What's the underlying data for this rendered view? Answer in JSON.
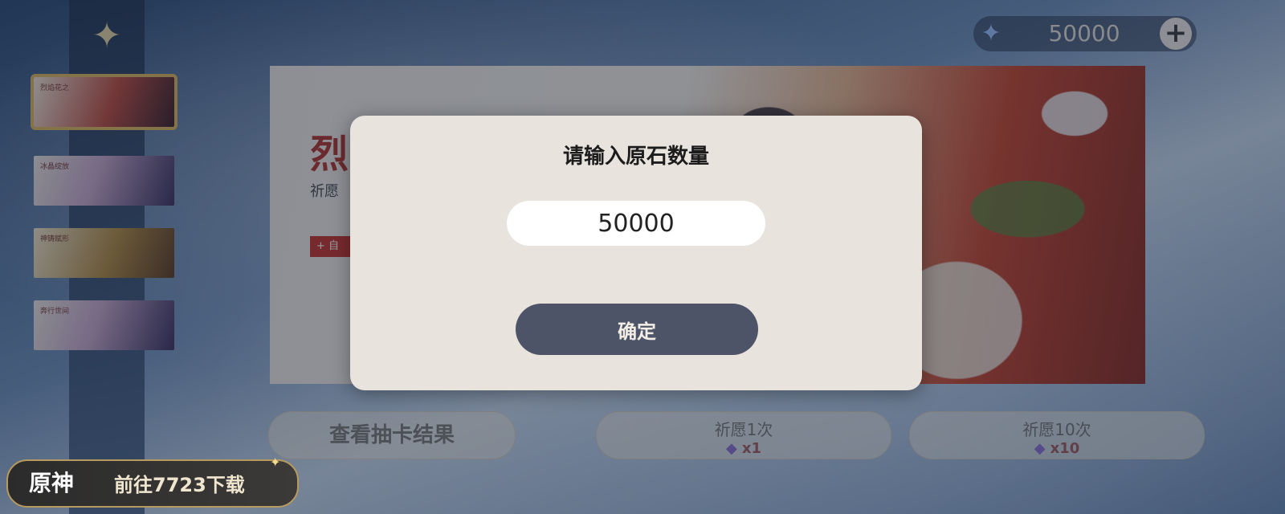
{
  "currency": {
    "amount": "50000",
    "icon": "primogem-icon",
    "add_label": "+"
  },
  "sidebar": {
    "banners": [
      {
        "label": "烈焰花之"
      },
      {
        "label": "冰晶绽放"
      },
      {
        "label": "神铸赋形"
      },
      {
        "label": "奔行世间"
      }
    ]
  },
  "banner": {
    "title_partial": "烈",
    "sub_partial": "祈愿",
    "tag_partial": "+ 自"
  },
  "buttons": {
    "view_results": "查看抽卡结果",
    "wish1_label": "祈愿1次",
    "wish1_cost": "x1",
    "wish10_label": "祈愿10次",
    "wish10_cost": "x10"
  },
  "download": {
    "logo": "原神",
    "text": "前往7723下载"
  },
  "modal": {
    "title": "请输入原石数量",
    "input_value": "50000",
    "confirm_label": "确定"
  },
  "colors": {
    "modal_bg": "#e8e3dd",
    "confirm_bg": "#4e5467",
    "accent_gold": "#e0b85a"
  }
}
